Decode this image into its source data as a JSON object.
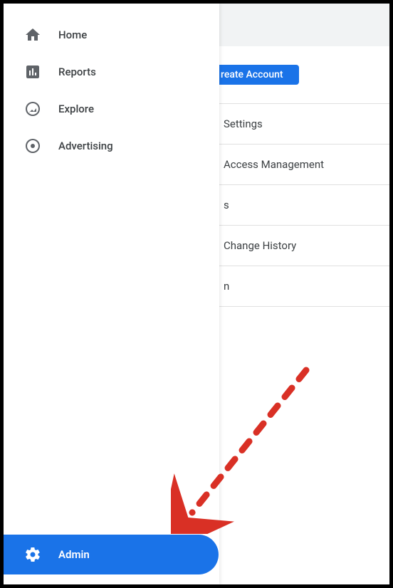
{
  "sidebar": {
    "items": [
      {
        "label": "Home",
        "icon": "home-icon"
      },
      {
        "label": "Reports",
        "icon": "reports-icon"
      },
      {
        "label": "Explore",
        "icon": "explore-icon"
      },
      {
        "label": "Advertising",
        "icon": "advertising-icon"
      }
    ],
    "admin": {
      "label": "Admin",
      "icon": "gear-icon"
    }
  },
  "content": {
    "create_account_label": "reate Account",
    "rows": [
      {
        "label": "Settings"
      },
      {
        "label": "Access Management"
      },
      {
        "label": "s"
      },
      {
        "label": "Change History"
      },
      {
        "label": "n"
      }
    ]
  },
  "colors": {
    "accent": "#1a73e8",
    "annotation": "#d93025"
  }
}
